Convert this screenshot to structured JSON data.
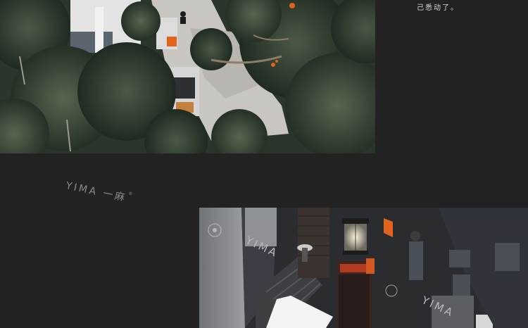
{
  "caption": {
    "text": "己悉动了。"
  },
  "watermark": {
    "brand": "YIMA",
    "chinese": "一麻",
    "registered": "®"
  },
  "photo_top": {
    "watermark": ""
  },
  "photo_bottom": {
    "watermark_1": "YIMA",
    "watermark_2": "YIMA"
  },
  "colors": {
    "background": "#222222",
    "foliage": "#2f3b30",
    "accent_orange": "#e0641c",
    "caption_text": "#d8d8d8"
  }
}
